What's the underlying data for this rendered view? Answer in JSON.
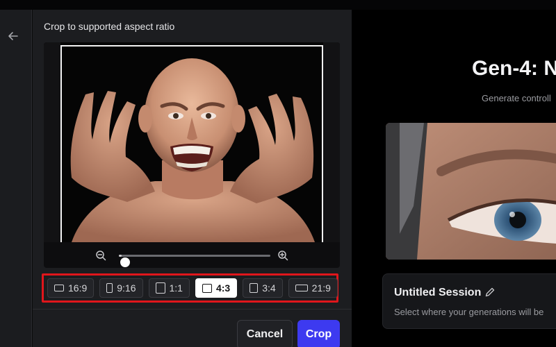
{
  "crop_dialog": {
    "title": "Crop to supported aspect ratio",
    "zoom": {
      "value": 0.02
    },
    "aspect_ratios": [
      {
        "label": "16:9",
        "active": false
      },
      {
        "label": "9:16",
        "active": false
      },
      {
        "label": "1:1",
        "active": false
      },
      {
        "label": "4:3",
        "active": true
      },
      {
        "label": "3:4",
        "active": false
      },
      {
        "label": "21:9",
        "active": false
      }
    ],
    "cancel_label": "Cancel",
    "crop_label": "Crop"
  },
  "right_panel": {
    "title": "Gen-4: N",
    "subtitle": "Generate controll",
    "session": {
      "title": "Untitled Session",
      "subtitle": "Select where your generations will be"
    }
  },
  "colors": {
    "accent": "#3d3af0",
    "highlight_border": "#e0161b",
    "panel_bg": "#1c1d20"
  },
  "icons": [
    "back-arrow-icon",
    "zoom-out-icon",
    "zoom-in-icon",
    "pencil-icon"
  ]
}
